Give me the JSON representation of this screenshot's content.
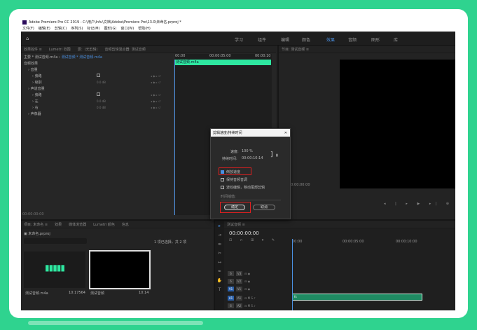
{
  "app": {
    "title": "Adobe Premiere Pro CC 2019 - C:\\用户\\lnfu\\文档\\Adobe\\Premiere Pro\\13.0\\未命名.prproj *",
    "menu": [
      "文件(F)",
      "编辑(E)",
      "剪辑(C)",
      "序列(S)",
      "标记(M)",
      "图形(G)",
      "窗口(W)",
      "帮助(H)"
    ],
    "workspaces": [
      "学习",
      "组件",
      "编辑",
      "颜色",
      "效果",
      "音频",
      "图形",
      "库"
    ],
    "active_workspace": "效果"
  },
  "effect_controls": {
    "tabs": [
      "效果控件 ≡",
      "Lumetri 范围",
      "源：(无剪辑)",
      "音频剪辑混合器: 测试音频"
    ],
    "source_label": "主要 * 测试音频.m4a",
    "sequence_label": "测试音频 * 测试音频.m4a",
    "section": "音频效果",
    "rows": [
      {
        "label": "› 音量",
        "indent": 0
      },
      {
        "label": "› 旁路",
        "indent": 1
      },
      {
        "label": "› 级别",
        "indent": 1
      },
      {
        "label": "› 声道音量",
        "indent": 0
      },
      {
        "label": "› 旁路",
        "indent": 1
      },
      {
        "label": "› 左",
        "indent": 1
      },
      {
        "label": "› 右",
        "indent": 1
      },
      {
        "label": "› 声像器",
        "indent": 0
      }
    ],
    "times": [
      "00:00",
      "00:00:05:00",
      "00:00:10"
    ],
    "clip_label": "测试音频.m4a",
    "timecode": "00:00:00:00"
  },
  "program": {
    "tab": "节目: 测试音频 ≡",
    "timecode": "00:00:00:00"
  },
  "dialog": {
    "title": "剪辑速度/持续时间",
    "speed_label": "速度:",
    "speed_value": "100 %",
    "duration_label": "持续时间:",
    "duration_value": "00:00:10:14",
    "options": [
      {
        "label": "倒放速度",
        "checked": true
      },
      {
        "label": "保持音频音调",
        "checked": false
      },
      {
        "label": "波纹编辑，移动尾部剪辑",
        "checked": false
      }
    ],
    "interp_label": "时间插值:",
    "ok_label": "确定",
    "cancel_label": "取消"
  },
  "project": {
    "tabs": [
      "项目: 未命名 ≡",
      "效果",
      "媒体浏览器",
      "Lumetri 颜色",
      "信息"
    ],
    "file": "未命名.prproj",
    "count": "1 项已选择，共 2 项",
    "items": [
      {
        "name": "测试音频.m4a",
        "duration": "10:17564"
      },
      {
        "name": "测试音频",
        "duration": "10:14"
      }
    ]
  },
  "timeline": {
    "tab": "测试音频 ≡",
    "timecode": "00:00:00:00",
    "ruler": [
      "00:00",
      "00:00:05:00",
      "00:00:10:00"
    ],
    "tracks": [
      "V3",
      "V2",
      "V1",
      "A1",
      "A2",
      "A3"
    ],
    "clip_label": "fx"
  },
  "colors": {
    "accent": "#4a90e2",
    "clip": "#2ee7a0",
    "highlight": "#e02020",
    "background": "#2fd38f"
  }
}
